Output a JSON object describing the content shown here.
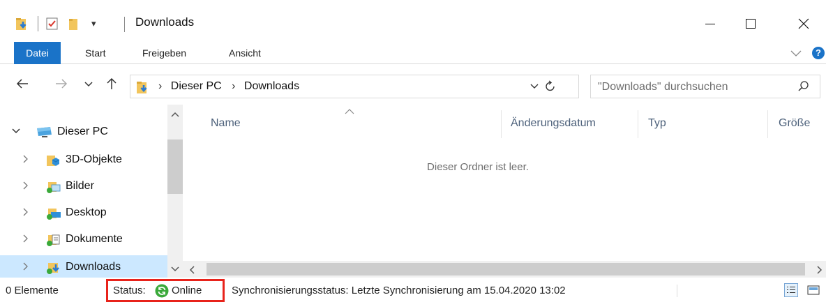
{
  "window": {
    "title": "Downloads",
    "qat_dropdown": "▾"
  },
  "ribbon": {
    "tabs": [
      {
        "label": "Datei"
      },
      {
        "label": "Start"
      },
      {
        "label": "Freigeben"
      },
      {
        "label": "Ansicht"
      }
    ],
    "help": "?"
  },
  "address": {
    "breadcrumb": [
      "Dieser PC",
      "Downloads"
    ],
    "separator": "›"
  },
  "search": {
    "placeholder": "\"Downloads\" durchsuchen"
  },
  "nav": {
    "items": [
      {
        "label": "Dieser PC",
        "icon": "pc-icon",
        "expanded": true
      },
      {
        "label": "3D-Objekte",
        "icon": "3d-objects-folder-icon"
      },
      {
        "label": "Bilder",
        "icon": "pictures-folder-icon"
      },
      {
        "label": "Desktop",
        "icon": "desktop-folder-icon"
      },
      {
        "label": "Dokumente",
        "icon": "documents-folder-icon"
      },
      {
        "label": "Downloads",
        "icon": "downloads-folder-icon",
        "selected": true
      }
    ]
  },
  "filelist": {
    "columns": [
      "Name",
      "Änderungsdatum",
      "Typ",
      "Größe"
    ],
    "sorted_column": "Name",
    "empty_message": "Dieser Ordner ist leer."
  },
  "statusbar": {
    "item_count": "0 Elemente",
    "status_label": "Status:",
    "status_value": "Online",
    "sync_text": "Synchronisierungsstatus:  Letzte Synchronisierung am 15.04.2020 13:02"
  },
  "colors": {
    "accent": "#1a73c8",
    "selection": "#cce8ff",
    "highlight_border": "#e8231b",
    "online_green": "#3aa93a"
  }
}
